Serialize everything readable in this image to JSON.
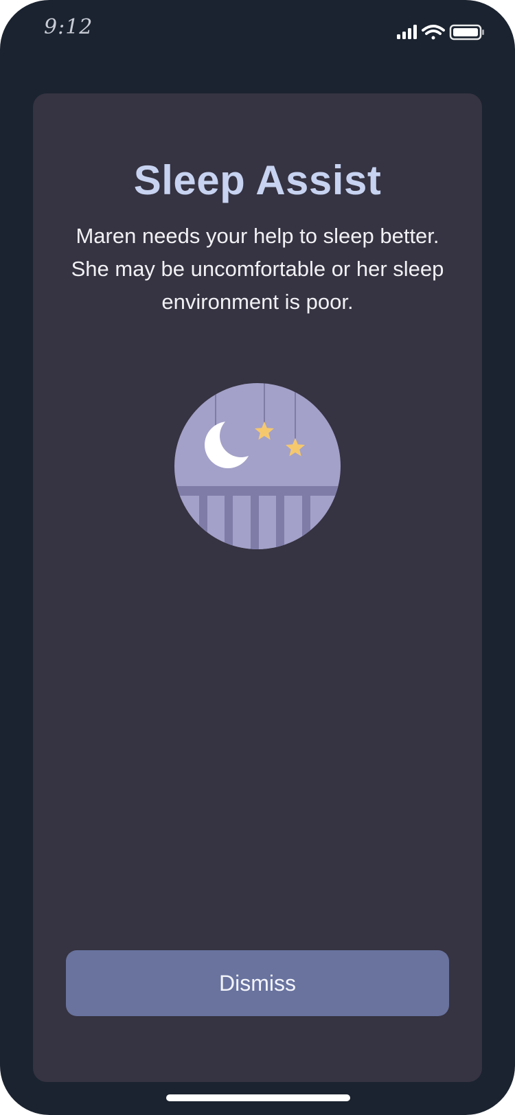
{
  "status_bar": {
    "time": "9:12",
    "icons": [
      "cellular-signal-icon",
      "wifi-icon",
      "battery-icon"
    ]
  },
  "sleep_assist": {
    "title": "Sleep Assist",
    "message": "Maren needs your help to sleep better. She may be uncomfortable or her sleep environment is poor.",
    "illustration": "crib-night-illustration",
    "dismiss_label": "Dismiss"
  },
  "colors": {
    "frame": "#1b2330",
    "card": "#363342",
    "title": "#c7d3f0",
    "button": "#69739e",
    "illustration_sky": "#a3a1c9",
    "star": "#f6c86e"
  }
}
